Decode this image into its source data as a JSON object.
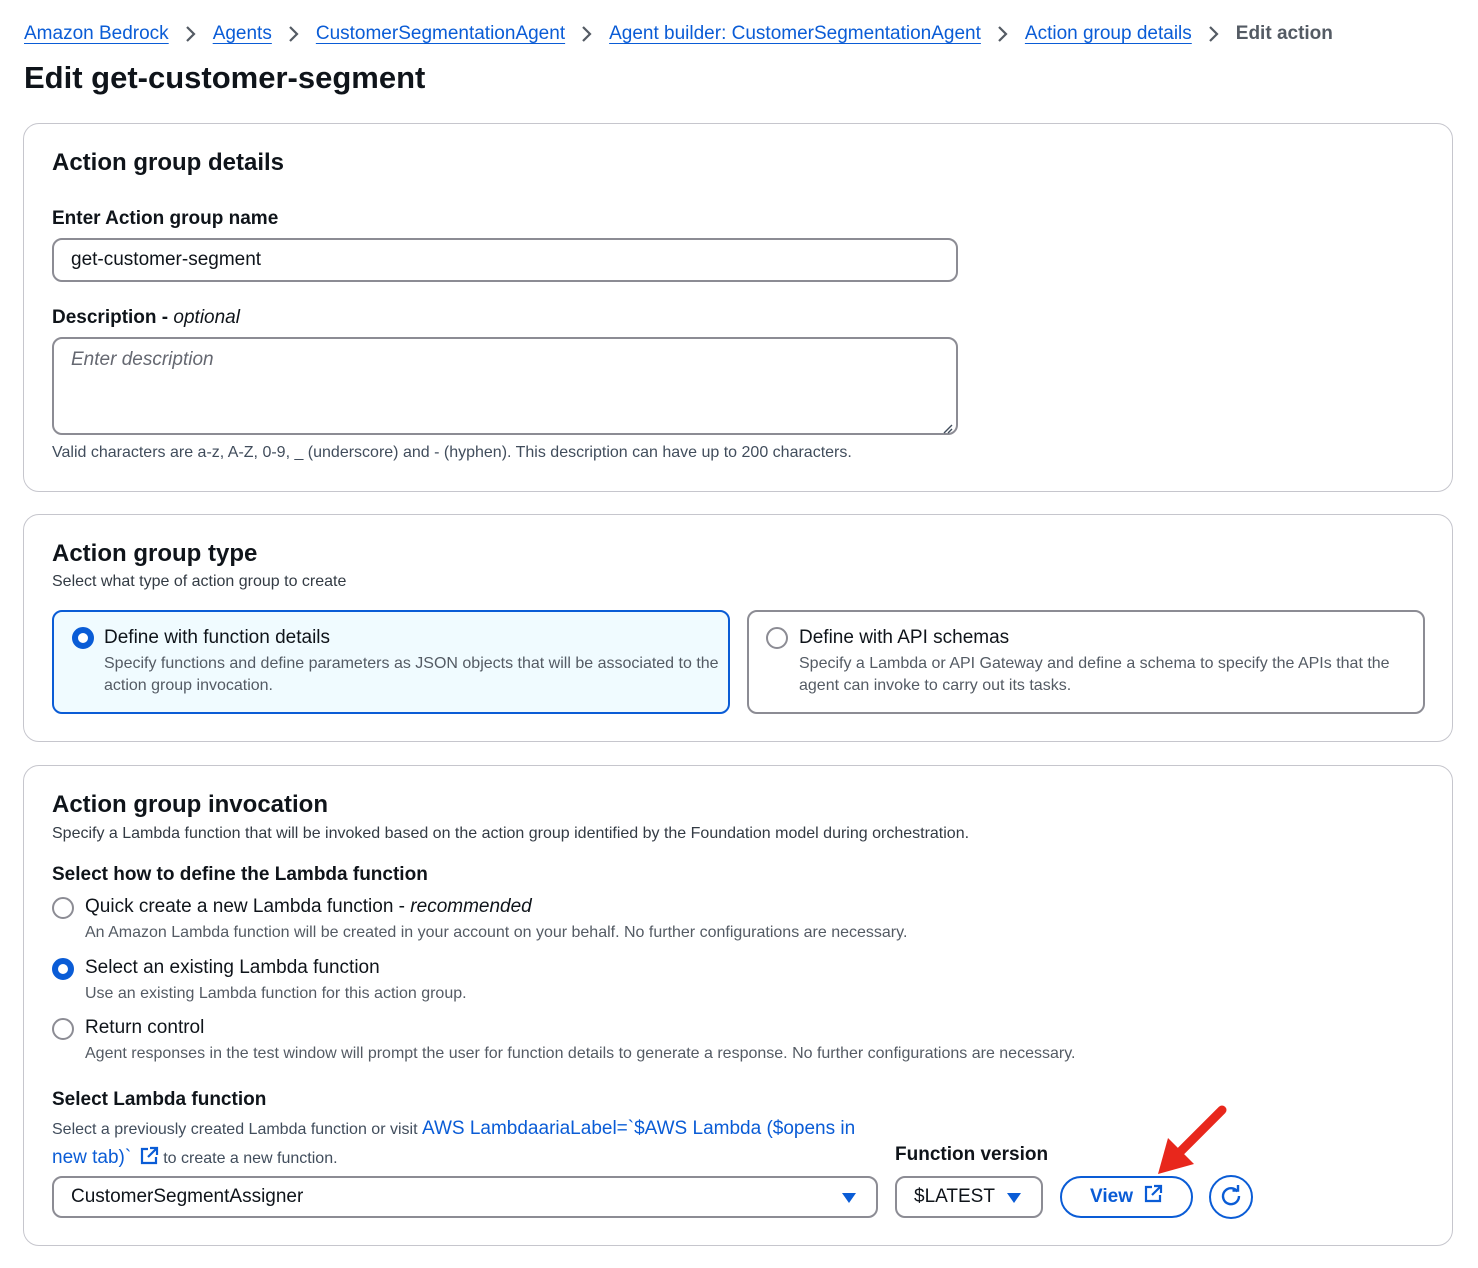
{
  "breadcrumb": {
    "items": [
      "Amazon Bedrock",
      "Agents",
      "CustomerSegmentationAgent",
      "Agent builder: CustomerSegmentationAgent",
      "Action group details"
    ],
    "current": "Edit action"
  },
  "page_title": "Edit get-customer-segment",
  "details": {
    "heading": "Action group details",
    "name_label": "Enter Action group name",
    "name_value": "get-customer-segment",
    "description_label": "Description -",
    "description_optional": "optional",
    "description_placeholder": "Enter description",
    "description_hint": "Valid characters are a-z, A-Z, 0-9, _ (underscore) and - (hyphen). This description can have up to 200 characters."
  },
  "type": {
    "heading": "Action group type",
    "subtitle": "Select what type of action group to create",
    "options": [
      {
        "title": "Define with function details",
        "description": "Specify functions and define parameters as JSON objects that will be associated to the action group invocation.",
        "selected": true
      },
      {
        "title": "Define with API schemas",
        "description": "Specify a Lambda or API Gateway and define a schema to specify the APIs that the agent can invoke to carry out its tasks.",
        "selected": false
      }
    ]
  },
  "invocation": {
    "heading": "Action group invocation",
    "subtitle": "Specify a Lambda function that will be invoked based on the action group identified by the Foundation model during orchestration.",
    "define_label": "Select how to define the Lambda function",
    "options": [
      {
        "title": "Quick create a new Lambda function -",
        "title_suffix": "recommended",
        "description": "An Amazon Lambda function will be created in your account on your behalf. No further configurations are necessary.",
        "selected": false
      },
      {
        "title": "Select an existing Lambda function",
        "title_suffix": "",
        "description": "Use an existing Lambda function for this action group.",
        "selected": true
      },
      {
        "title": "Return control",
        "title_suffix": "",
        "description": "Agent responses in the test window will prompt the user for function details to generate a response. No further configurations are necessary.",
        "selected": false
      }
    ],
    "lambda_label": "Select Lambda function",
    "lambda_help_prefix": "Select a previously created Lambda function or visit",
    "lambda_help_link": "AWS LambdaariaLabel=`$AWS Lambda ($opens in new tab)`",
    "lambda_help_suffix": "to create a new function.",
    "lambda_value": "CustomerSegmentAssigner",
    "version_label": "Function version",
    "version_value": "$LATEST",
    "view_button": "View"
  },
  "colors": {
    "accent": "#0a5cd6",
    "annotation_arrow": "#e8271c"
  },
  "icons": [
    "chevron-right-icon",
    "external-link-icon",
    "refresh-icon",
    "caret-down-icon",
    "resize-grip-icon",
    "red-arrow-annotation"
  ]
}
